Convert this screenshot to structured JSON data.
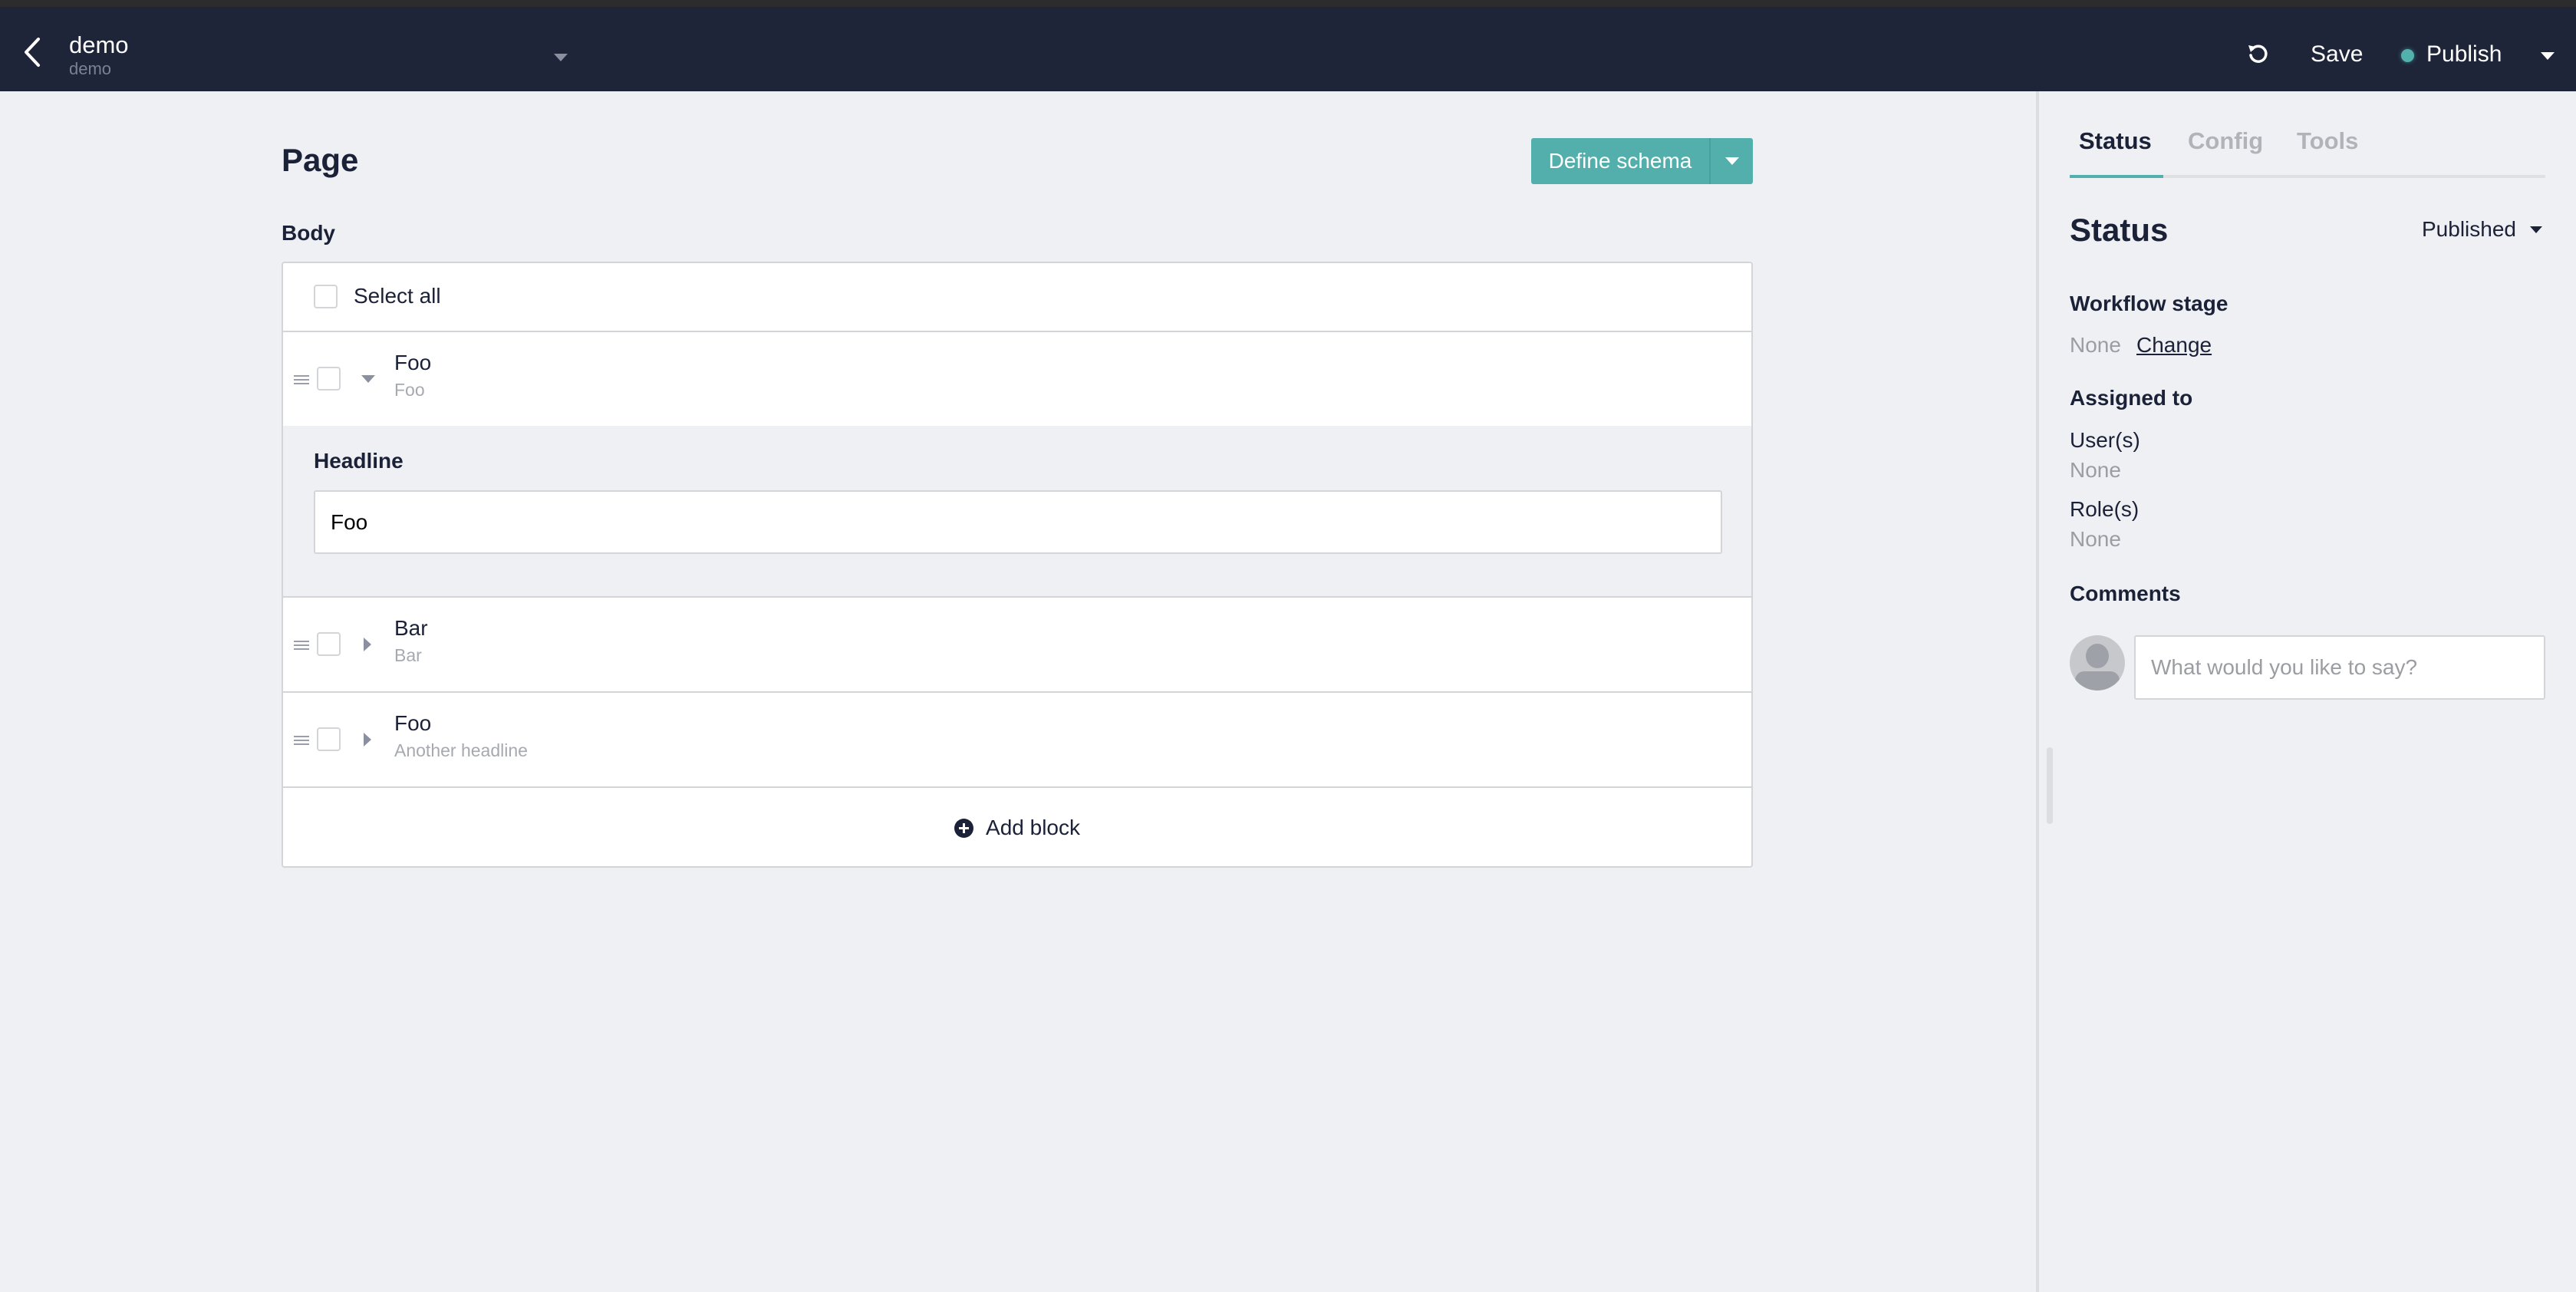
{
  "header": {
    "title": "demo",
    "subtitle": "demo",
    "save_label": "Save",
    "publish_label": "Publish",
    "publish_status_color": "#52b1ad",
    "icons": {
      "back": "chevron-left-icon",
      "undo": "undo-icon"
    }
  },
  "main": {
    "page_title": "Page",
    "define_schema_label": "Define schema",
    "accent_color": "#52afac",
    "body_label": "Body",
    "select_all_label": "Select all",
    "blocks": [
      {
        "title": "Foo",
        "subtitle": "Foo",
        "expanded": true,
        "fields": [
          {
            "label": "Headline",
            "value": "Foo"
          }
        ]
      },
      {
        "title": "Bar",
        "subtitle": "Bar",
        "expanded": false
      },
      {
        "title": "Foo",
        "subtitle": "Another headline",
        "expanded": false
      }
    ],
    "add_block_label": "Add block"
  },
  "sidebar": {
    "tabs": [
      {
        "label": "Status",
        "active": true
      },
      {
        "label": "Config",
        "active": false
      },
      {
        "label": "Tools",
        "active": false
      }
    ],
    "title": "Status",
    "status_value": "Published",
    "workflow_stage": {
      "heading": "Workflow stage",
      "value": "None",
      "change_label": "Change"
    },
    "assigned_to": {
      "heading": "Assigned to",
      "users_label": "User(s)",
      "users_value": "None",
      "roles_label": "Role(s)",
      "roles_value": "None"
    },
    "comments": {
      "heading": "Comments",
      "placeholder": "What would you like to say?",
      "value": ""
    }
  }
}
